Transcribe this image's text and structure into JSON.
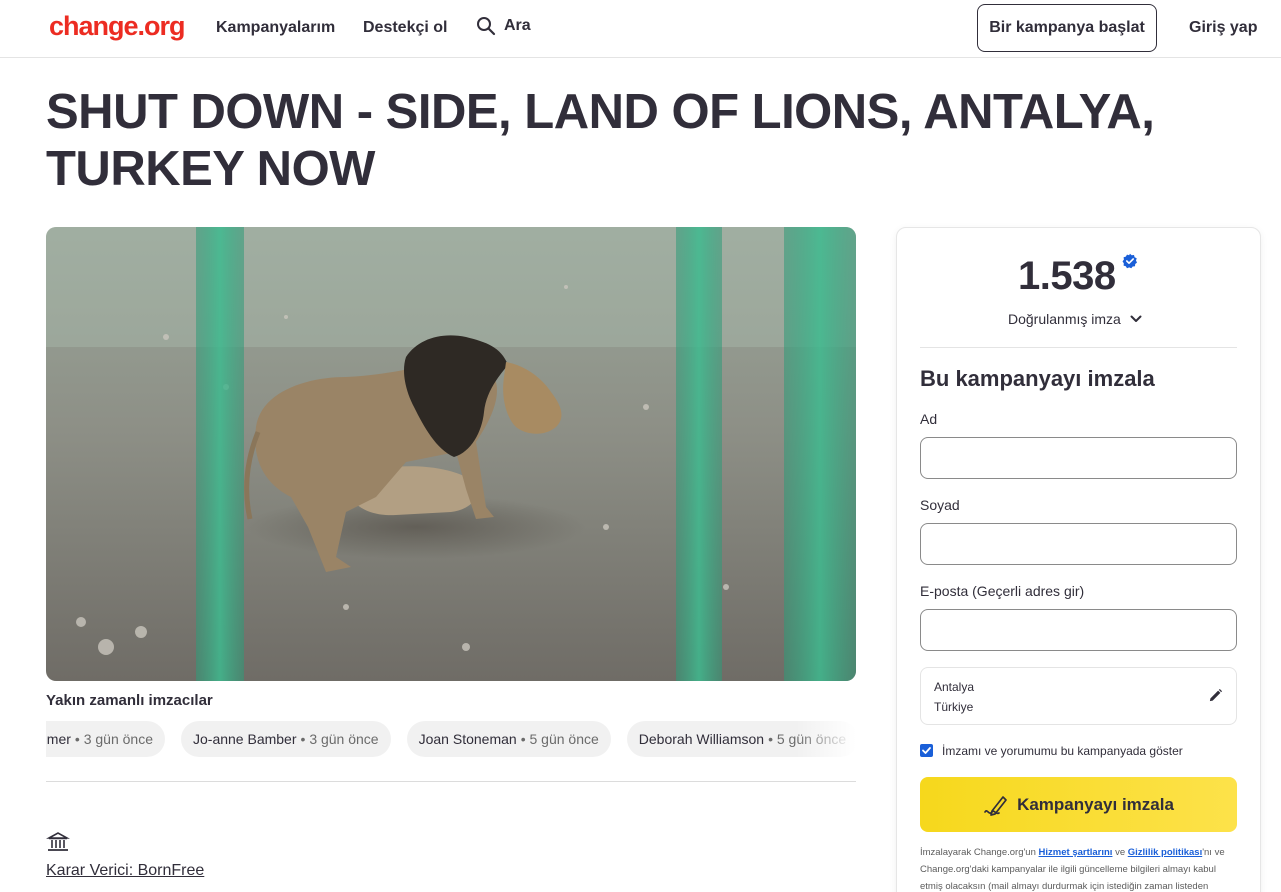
{
  "header": {
    "logo": "change.org",
    "nav": {
      "my_campaigns": "Kampanyalarım",
      "become_supporter": "Destekçi ol",
      "search": "Ara"
    },
    "start_campaign": "Bir kampanya başlat",
    "login": "Giriş yap"
  },
  "petition": {
    "title": "SHUT DOWN - SIDE, LAND OF LIONS, ANTALYA, TURKEY NOW",
    "recent_signers_heading": "Yakın zamanlı imzacılar",
    "recent_signers": [
      {
        "name": "Pammer",
        "time": "3 gün önce"
      },
      {
        "name": "Jo-anne Bamber",
        "time": "3 gün önce"
      },
      {
        "name": "Joan Stoneman",
        "time": "5 gün önce"
      },
      {
        "name": "Deborah Williamson",
        "time": "5 gün önce"
      }
    ],
    "decision_maker": "Karar Verici: BornFree"
  },
  "sign_card": {
    "count": "1.538",
    "verified_label": "Doğrulanmış imza",
    "heading": "Bu kampanyayı imzala",
    "fields": {
      "first_name_label": "Ad",
      "first_name_value": "",
      "last_name_label": "Soyad",
      "last_name_value": "",
      "email_label": "E-posta (Geçerli adres gir)",
      "email_value": ""
    },
    "location": {
      "city": "Antalya",
      "country": "Türkiye"
    },
    "show_signature_label": "İmzamı ve yorumumu bu kampanyada göster",
    "show_signature_checked": true,
    "sign_button": "Kampanyayı imzala",
    "legal": {
      "part1": "İmzalayarak Change.org'un ",
      "terms": "Hizmet şartlarını",
      "part2": " ve ",
      "privacy": "Gizlilik politikası",
      "part3": "'nı ve Change.org'daki kampanyalar ile ilgili güncelleme bilgileri almayı kabul etmiş olacaksın (mail almayı durdurmak için istediğin zaman listeden"
    }
  },
  "colors": {
    "brand_red": "#ec2c22",
    "text_dark": "#312e3a",
    "sign_button_yellow": "#f6d81c",
    "verified_blue": "#1a5fd8"
  },
  "icons": [
    "search-icon",
    "verified-badge-icon",
    "chevron-down-icon",
    "edit-pencil-icon",
    "checkbox-checked-icon",
    "signature-pen-icon",
    "decision-maker-building-icon"
  ]
}
